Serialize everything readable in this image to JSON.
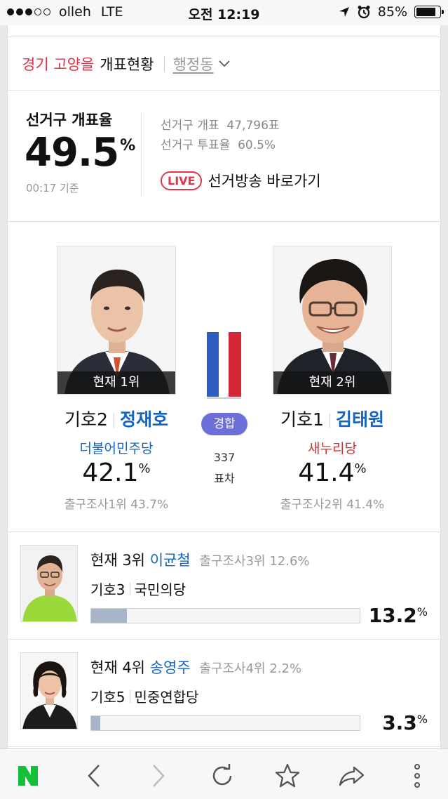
{
  "status_bar": {
    "carrier": "olleh",
    "network": "LTE",
    "time": "오전 12:19",
    "battery": "85%",
    "battery_level": 0.85
  },
  "header": {
    "region": "경기 고양을",
    "title": "개표현황",
    "dropdown_label": "행정동"
  },
  "summary": {
    "label": "선거구 개표율",
    "rate": "49.5",
    "rate_unit": "%",
    "as_of": "00:17 기준",
    "count_label": "선거구 개표",
    "count_value": "47,796표",
    "turnout_label": "선거구 투표율",
    "turnout_value": "60.5%",
    "live_badge": "LIVE",
    "live_link": "선거방송 바로가기"
  },
  "leaders": [
    {
      "rank": "현재 1위",
      "number": "기호2",
      "name": "정재호",
      "party": "더불어민주당",
      "party_color": "#1565c0",
      "vote": "42.1",
      "unit": "%",
      "exit": "출구조사1위 43.7%"
    },
    {
      "rank": "현재 2위",
      "number": "기호1",
      "name": "김태원",
      "party": "새누리당",
      "party_color": "#d32f2f",
      "vote": "41.4",
      "unit": "%",
      "exit": "출구조사2위 41.4%"
    }
  ],
  "race": {
    "status": "경합",
    "margin": "337",
    "margin_label": "표차"
  },
  "others": [
    {
      "rank": "현재 3위",
      "name": "이균철",
      "exit": "출구조사3위 12.6%",
      "number": "기호3",
      "party": "국민의당",
      "vote": "13.2",
      "unit": "%",
      "share": 13.2
    },
    {
      "rank": "현재 4위",
      "name": "송영주",
      "exit": "출구조사4위 2.2%",
      "number": "기호5",
      "party": "민중연합당",
      "vote": "3.3",
      "unit": "%",
      "share": 3.3
    }
  ],
  "toolbar": {
    "items": [
      "naver-icon",
      "back-icon",
      "forward-icon",
      "reload-icon",
      "bookmark-star-icon",
      "share-icon",
      "more-icon"
    ],
    "brand_color": "#03c75a"
  }
}
